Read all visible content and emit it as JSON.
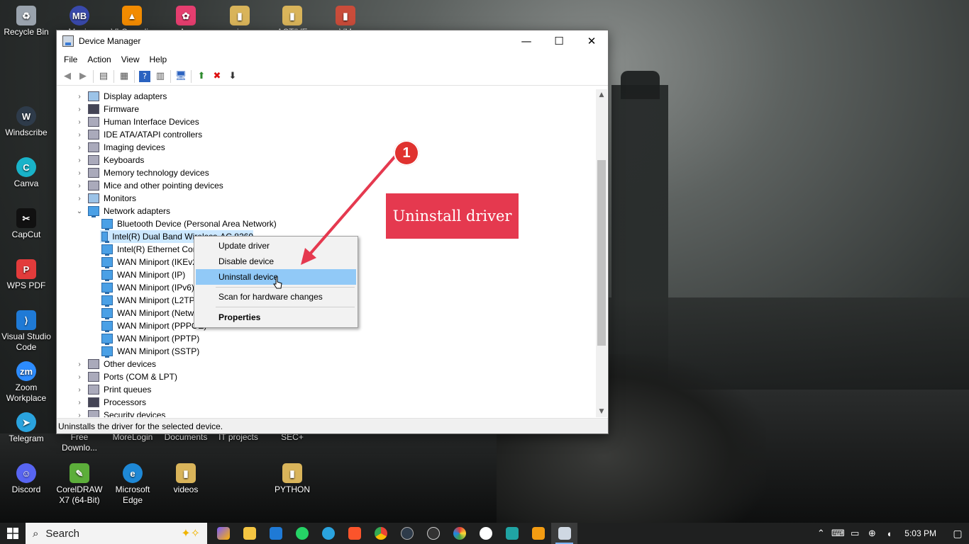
{
  "window": {
    "title": "Device Manager",
    "minimize": "—",
    "maximize": "☐",
    "close": "✕"
  },
  "menu": [
    "File",
    "Action",
    "View",
    "Help"
  ],
  "tree": {
    "items": [
      {
        "label": "Display adapters",
        "icon": "display-icon"
      },
      {
        "label": "Firmware",
        "icon": "firmware-icon"
      },
      {
        "label": "Human Interface Devices",
        "icon": "hid-icon"
      },
      {
        "label": "IDE ATA/ATAPI controllers",
        "icon": "ide-icon"
      },
      {
        "label": "Imaging devices",
        "icon": "camera-icon"
      },
      {
        "label": "Keyboards",
        "icon": "keyboard-icon"
      },
      {
        "label": "Memory technology devices",
        "icon": "memory-icon"
      },
      {
        "label": "Mice and other pointing devices",
        "icon": "mouse-icon"
      },
      {
        "label": "Monitors",
        "icon": "monitor-icon"
      },
      {
        "label": "Network adapters",
        "icon": "network-icon",
        "expanded": true
      },
      {
        "label": "Bluetooth Device (Personal Area Network)",
        "icon": "network-adapter-icon"
      },
      {
        "label": "Intel(R) Dual Band Wireless-AC 8260",
        "icon": "network-adapter-icon",
        "selected": true
      },
      {
        "label": "Intel(R) Ethernet Connection",
        "icon": "network-adapter-icon"
      },
      {
        "label": "WAN Miniport (IKEv2)",
        "icon": "network-adapter-icon"
      },
      {
        "label": "WAN Miniport (IP)",
        "icon": "network-adapter-icon"
      },
      {
        "label": "WAN Miniport (IPv6)",
        "icon": "network-adapter-icon"
      },
      {
        "label": "WAN Miniport (L2TP)",
        "icon": "network-adapter-icon"
      },
      {
        "label": "WAN Miniport (Network Monitor)",
        "icon": "network-adapter-icon"
      },
      {
        "label": "WAN Miniport (PPPOE)",
        "icon": "network-adapter-icon"
      },
      {
        "label": "WAN Miniport (PPTP)",
        "icon": "network-adapter-icon"
      },
      {
        "label": "WAN Miniport (SSTP)",
        "icon": "network-adapter-icon"
      },
      {
        "label": "Other devices",
        "icon": "warning-device-icon"
      },
      {
        "label": "Ports (COM & LPT)",
        "icon": "port-icon"
      },
      {
        "label": "Print queues",
        "icon": "printer-icon"
      },
      {
        "label": "Processors",
        "icon": "processor-icon"
      },
      {
        "label": "Security devices",
        "icon": "security-icon"
      }
    ]
  },
  "context_menu": {
    "update": "Update driver",
    "disable": "Disable device",
    "uninstall": "Uninstall device",
    "scan": "Scan for hardware changes",
    "properties": "Properties"
  },
  "status": "Uninstalls the driver for the selected device.",
  "annotation": {
    "badge": "1",
    "callout": "Uninstall driver",
    "color": "#e5394f"
  },
  "desktop": {
    "icons": [
      {
        "label": "Recycle Bin"
      },
      {
        "label": "Mavis"
      },
      {
        "label": "VLC media"
      },
      {
        "label": "Arc"
      },
      {
        "label": "pics"
      },
      {
        "label": "ACTIVE"
      },
      {
        "label": "VM"
      },
      {
        "label": "Windscribe"
      },
      {
        "label": "Canva"
      },
      {
        "label": "CapCut"
      },
      {
        "label": "WPS PDF"
      },
      {
        "label": "Visual Studio Code"
      },
      {
        "label": "Zoom Workplace"
      },
      {
        "label": "Telegram"
      },
      {
        "label": "Discord"
      },
      {
        "label": "CorelDRAW X7 (64-Bit)"
      },
      {
        "label": "Microsoft Edge"
      },
      {
        "label": "videos"
      },
      {
        "label": "PYTHON"
      },
      {
        "label": "Free Downlo..."
      },
      {
        "label": "MoreLogin"
      },
      {
        "label": "Documents"
      },
      {
        "label": "IT projects"
      },
      {
        "label": "SEC+"
      }
    ]
  },
  "taskbar": {
    "search_placeholder": "Search",
    "time": "5:03 PM"
  }
}
